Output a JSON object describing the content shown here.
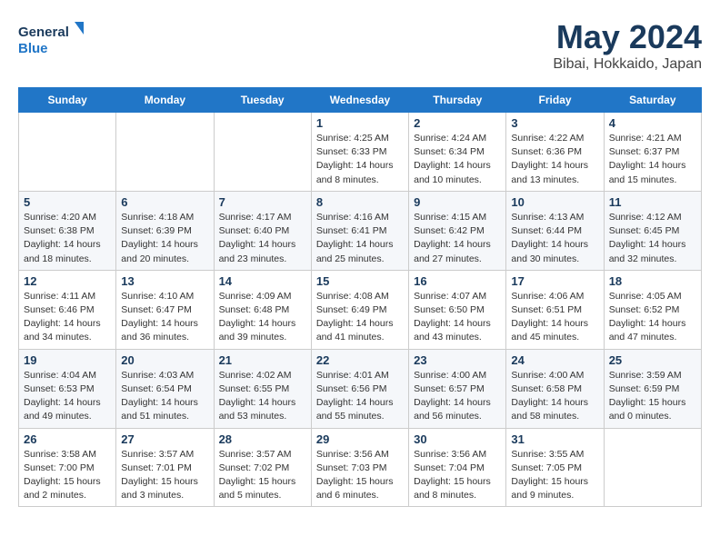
{
  "header": {
    "logo_line1": "General",
    "logo_line2": "Blue",
    "month_title": "May 2024",
    "location": "Bibai, Hokkaido, Japan"
  },
  "days_of_week": [
    "Sunday",
    "Monday",
    "Tuesday",
    "Wednesday",
    "Thursday",
    "Friday",
    "Saturday"
  ],
  "weeks": [
    [
      {
        "day": "",
        "info": ""
      },
      {
        "day": "",
        "info": ""
      },
      {
        "day": "",
        "info": ""
      },
      {
        "day": "1",
        "info": "Sunrise: 4:25 AM\nSunset: 6:33 PM\nDaylight: 14 hours\nand 8 minutes."
      },
      {
        "day": "2",
        "info": "Sunrise: 4:24 AM\nSunset: 6:34 PM\nDaylight: 14 hours\nand 10 minutes."
      },
      {
        "day": "3",
        "info": "Sunrise: 4:22 AM\nSunset: 6:36 PM\nDaylight: 14 hours\nand 13 minutes."
      },
      {
        "day": "4",
        "info": "Sunrise: 4:21 AM\nSunset: 6:37 PM\nDaylight: 14 hours\nand 15 minutes."
      }
    ],
    [
      {
        "day": "5",
        "info": "Sunrise: 4:20 AM\nSunset: 6:38 PM\nDaylight: 14 hours\nand 18 minutes."
      },
      {
        "day": "6",
        "info": "Sunrise: 4:18 AM\nSunset: 6:39 PM\nDaylight: 14 hours\nand 20 minutes."
      },
      {
        "day": "7",
        "info": "Sunrise: 4:17 AM\nSunset: 6:40 PM\nDaylight: 14 hours\nand 23 minutes."
      },
      {
        "day": "8",
        "info": "Sunrise: 4:16 AM\nSunset: 6:41 PM\nDaylight: 14 hours\nand 25 minutes."
      },
      {
        "day": "9",
        "info": "Sunrise: 4:15 AM\nSunset: 6:42 PM\nDaylight: 14 hours\nand 27 minutes."
      },
      {
        "day": "10",
        "info": "Sunrise: 4:13 AM\nSunset: 6:44 PM\nDaylight: 14 hours\nand 30 minutes."
      },
      {
        "day": "11",
        "info": "Sunrise: 4:12 AM\nSunset: 6:45 PM\nDaylight: 14 hours\nand 32 minutes."
      }
    ],
    [
      {
        "day": "12",
        "info": "Sunrise: 4:11 AM\nSunset: 6:46 PM\nDaylight: 14 hours\nand 34 minutes."
      },
      {
        "day": "13",
        "info": "Sunrise: 4:10 AM\nSunset: 6:47 PM\nDaylight: 14 hours\nand 36 minutes."
      },
      {
        "day": "14",
        "info": "Sunrise: 4:09 AM\nSunset: 6:48 PM\nDaylight: 14 hours\nand 39 minutes."
      },
      {
        "day": "15",
        "info": "Sunrise: 4:08 AM\nSunset: 6:49 PM\nDaylight: 14 hours\nand 41 minutes."
      },
      {
        "day": "16",
        "info": "Sunrise: 4:07 AM\nSunset: 6:50 PM\nDaylight: 14 hours\nand 43 minutes."
      },
      {
        "day": "17",
        "info": "Sunrise: 4:06 AM\nSunset: 6:51 PM\nDaylight: 14 hours\nand 45 minutes."
      },
      {
        "day": "18",
        "info": "Sunrise: 4:05 AM\nSunset: 6:52 PM\nDaylight: 14 hours\nand 47 minutes."
      }
    ],
    [
      {
        "day": "19",
        "info": "Sunrise: 4:04 AM\nSunset: 6:53 PM\nDaylight: 14 hours\nand 49 minutes."
      },
      {
        "day": "20",
        "info": "Sunrise: 4:03 AM\nSunset: 6:54 PM\nDaylight: 14 hours\nand 51 minutes."
      },
      {
        "day": "21",
        "info": "Sunrise: 4:02 AM\nSunset: 6:55 PM\nDaylight: 14 hours\nand 53 minutes."
      },
      {
        "day": "22",
        "info": "Sunrise: 4:01 AM\nSunset: 6:56 PM\nDaylight: 14 hours\nand 55 minutes."
      },
      {
        "day": "23",
        "info": "Sunrise: 4:00 AM\nSunset: 6:57 PM\nDaylight: 14 hours\nand 56 minutes."
      },
      {
        "day": "24",
        "info": "Sunrise: 4:00 AM\nSunset: 6:58 PM\nDaylight: 14 hours\nand 58 minutes."
      },
      {
        "day": "25",
        "info": "Sunrise: 3:59 AM\nSunset: 6:59 PM\nDaylight: 15 hours\nand 0 minutes."
      }
    ],
    [
      {
        "day": "26",
        "info": "Sunrise: 3:58 AM\nSunset: 7:00 PM\nDaylight: 15 hours\nand 2 minutes."
      },
      {
        "day": "27",
        "info": "Sunrise: 3:57 AM\nSunset: 7:01 PM\nDaylight: 15 hours\nand 3 minutes."
      },
      {
        "day": "28",
        "info": "Sunrise: 3:57 AM\nSunset: 7:02 PM\nDaylight: 15 hours\nand 5 minutes."
      },
      {
        "day": "29",
        "info": "Sunrise: 3:56 AM\nSunset: 7:03 PM\nDaylight: 15 hours\nand 6 minutes."
      },
      {
        "day": "30",
        "info": "Sunrise: 3:56 AM\nSunset: 7:04 PM\nDaylight: 15 hours\nand 8 minutes."
      },
      {
        "day": "31",
        "info": "Sunrise: 3:55 AM\nSunset: 7:05 PM\nDaylight: 15 hours\nand 9 minutes."
      },
      {
        "day": "",
        "info": ""
      }
    ]
  ]
}
